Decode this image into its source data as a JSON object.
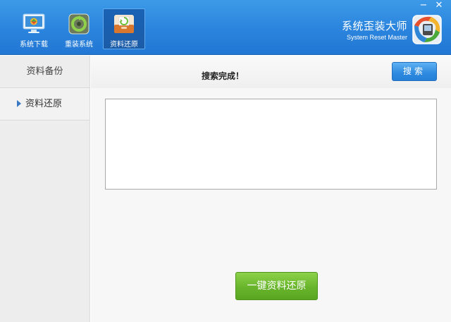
{
  "window_controls": {
    "minimize": "−",
    "close": "✕"
  },
  "nav": {
    "items": [
      {
        "label": "系统下载",
        "icon": "monitor-download-icon",
        "active": false
      },
      {
        "label": "重装系统",
        "icon": "reinstall-recycle-icon",
        "active": false
      },
      {
        "label": "资料还原",
        "icon": "restore-box-icon",
        "active": true
      }
    ]
  },
  "brand": {
    "title": "系统歪装大师",
    "subtitle": "System Reset Master",
    "logo_icon": "app-logo-icon"
  },
  "sidebar": {
    "items": [
      {
        "label": "资料备份",
        "active": false
      },
      {
        "label": "资料还原",
        "active": true
      }
    ]
  },
  "main": {
    "status": "搜索完成！",
    "search_label": "搜索",
    "restore_label": "一键资料还原"
  },
  "colors": {
    "header_blue": "#2a84dd",
    "button_blue": "#2d8ae0",
    "button_green": "#68b52c",
    "sidebar_bg": "#ededed"
  }
}
